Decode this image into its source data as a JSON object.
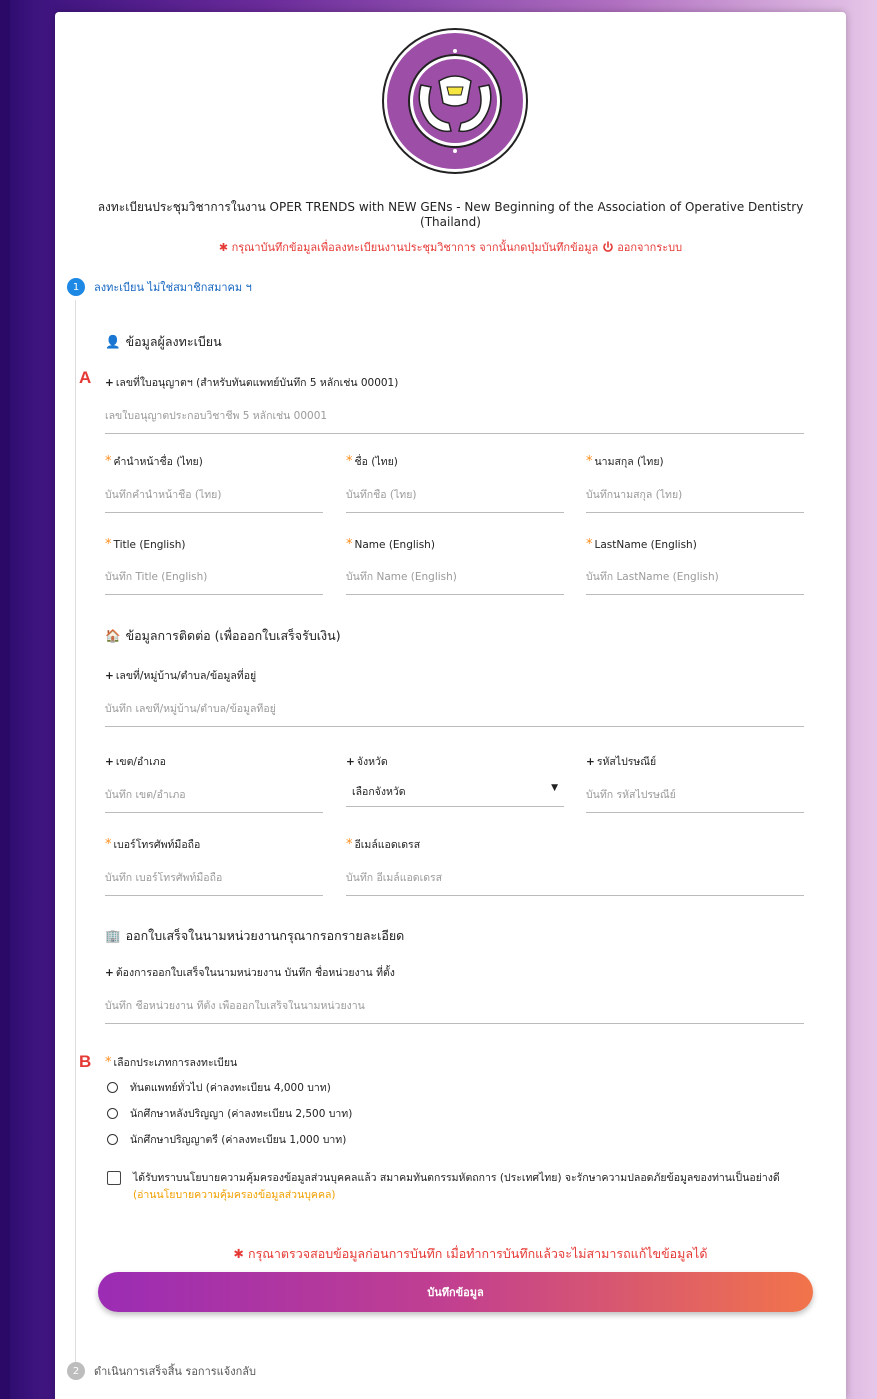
{
  "colors": {
    "accent": "#1e88e5",
    "required": "#ff8c1a",
    "warning": "#e53935",
    "button_start": "#9b2cb4",
    "button_end": "#f2744a"
  },
  "header": {
    "title": "ลงทะเบียนประชุมวิชาการในงาน OPER TRENDS with NEW GENs - New Beginning of the Association of Operative Dentistry (Thailand)",
    "warning": "กรุณาบันทึกข้อมูลเพื่อลงทะเบียนงานประชุมวิชาการ จากนั้นกดปุ่มบันทึกข้อมูล",
    "logout": "ออกจากระบบ",
    "logo_icon": "association-seal-icon"
  },
  "steps": [
    {
      "num": "1",
      "label": "ลงทะเบียน ไม่ใช่สมาชิกสมาคม ฯ"
    },
    {
      "num": "2",
      "label": "ดำเนินการเสร็จสิ้น รอการแจ้งกลับ"
    }
  ],
  "markers": {
    "a": "A",
    "b": "B"
  },
  "sections": {
    "registrant": "ข้อมูลผู้ลงทะเบียน",
    "contact": "ข้อมูลการติดต่อ (เพื่อออกใบเสร็จรับเงิน)",
    "receipt": "ออกใบเสร็จในนามหน่วยงานกรุณากรอกรายละเอียด"
  },
  "fields": {
    "license": {
      "label": "เลขที่ใบอนุญาตฯ (สำหรับทันตแพทย์บันทึก 5 หลักเช่น 00001)",
      "placeholder": "เลขใบอนุญาตประกอบวิชาชีพ 5 หลักเช่น 00001"
    },
    "prefix_th": {
      "label": "คำนำหน้าชื่อ (ไทย)",
      "placeholder": "บันทึกคำนำหน้าชื่อ (ไทย)"
    },
    "name_th": {
      "label": "ชื่อ (ไทย)",
      "placeholder": "บันทึกชื่อ (ไทย)"
    },
    "lastname_th": {
      "label": "นามสกุล (ไทย)",
      "placeholder": "บันทึกนามสกุล (ไทย)"
    },
    "title_en": {
      "label": "Title (English)",
      "placeholder": "บันทึก Title (English)"
    },
    "name_en": {
      "label": "Name (English)",
      "placeholder": "บันทึก Name (English)"
    },
    "lastname_en": {
      "label": "LastName (English)",
      "placeholder": "บันทึก LastName (English)"
    },
    "address": {
      "label": "เลขที่/หมู่บ้าน/ตำบล/ข้อมูลที่อยู่",
      "placeholder": "บันทึก เลขที่/หมู่บ้าน/ตำบล/ข้อมูลที่อยู่"
    },
    "district": {
      "label": "เขต/อำเภอ",
      "placeholder": "บันทึก เขต/อำเภอ"
    },
    "province": {
      "label": "จังหวัด",
      "value": "เลือกจังหวัด"
    },
    "postcode": {
      "label": "รหัสไปรษณีย์",
      "placeholder": "บันทึก รหัสไปรษณีย์"
    },
    "phone": {
      "label": "เบอร์โทรศัพท์มือถือ",
      "placeholder": "บันทึก เบอร์โทรศัพท์มือถือ"
    },
    "email": {
      "label": "อีเมล์แอดเดรส",
      "placeholder": "บันทึก อีเมล์แอดเดรส"
    },
    "org": {
      "label": "ต้องการออกใบเสร็จในนามหน่วยงาน บันทึก ชื่อหน่วยงาน ที่ตั้ง",
      "placeholder": "บันทึก ชื่อหน่วยงาน ที่ตั้ง เพื่อออกใบเสร็จในนามหน่วยงาน"
    }
  },
  "registration_type": {
    "label": "เลือกประเภทการลงทะเบียน",
    "options": [
      "ทันตแพทย์ทั่วไป (ค่าลงทะเบียน 4,000 บาท)",
      "นักศึกษาหลังปริญญา (ค่าลงทะเบียน 2,500 บาท)",
      "นักศึกษาปริญญาตรี (ค่าลงทะเบียน 1,000 บาท)"
    ]
  },
  "consent": {
    "text": "ได้รับทราบนโยบายความคุ้มครองข้อมูลส่วนบุคคลแล้ว สมาคมทันตกรรมหัตถการ (ประเทศไทย) จะรักษาความปลอดภัยข้อมูลของท่านเป็นอย่างดี",
    "link": "(อ่านนโยบายความคุ้มครองข้อมูลส่วนบุคคล)"
  },
  "bottom_warning": "กรุณาตรวจสอบข้อมูลก่อนการบันทึก เมื่อทำการบันทึกแล้วจะไม่สามารถแก้ไขข้อมูลได้",
  "submit_label": "บันทึกข้อมูล"
}
